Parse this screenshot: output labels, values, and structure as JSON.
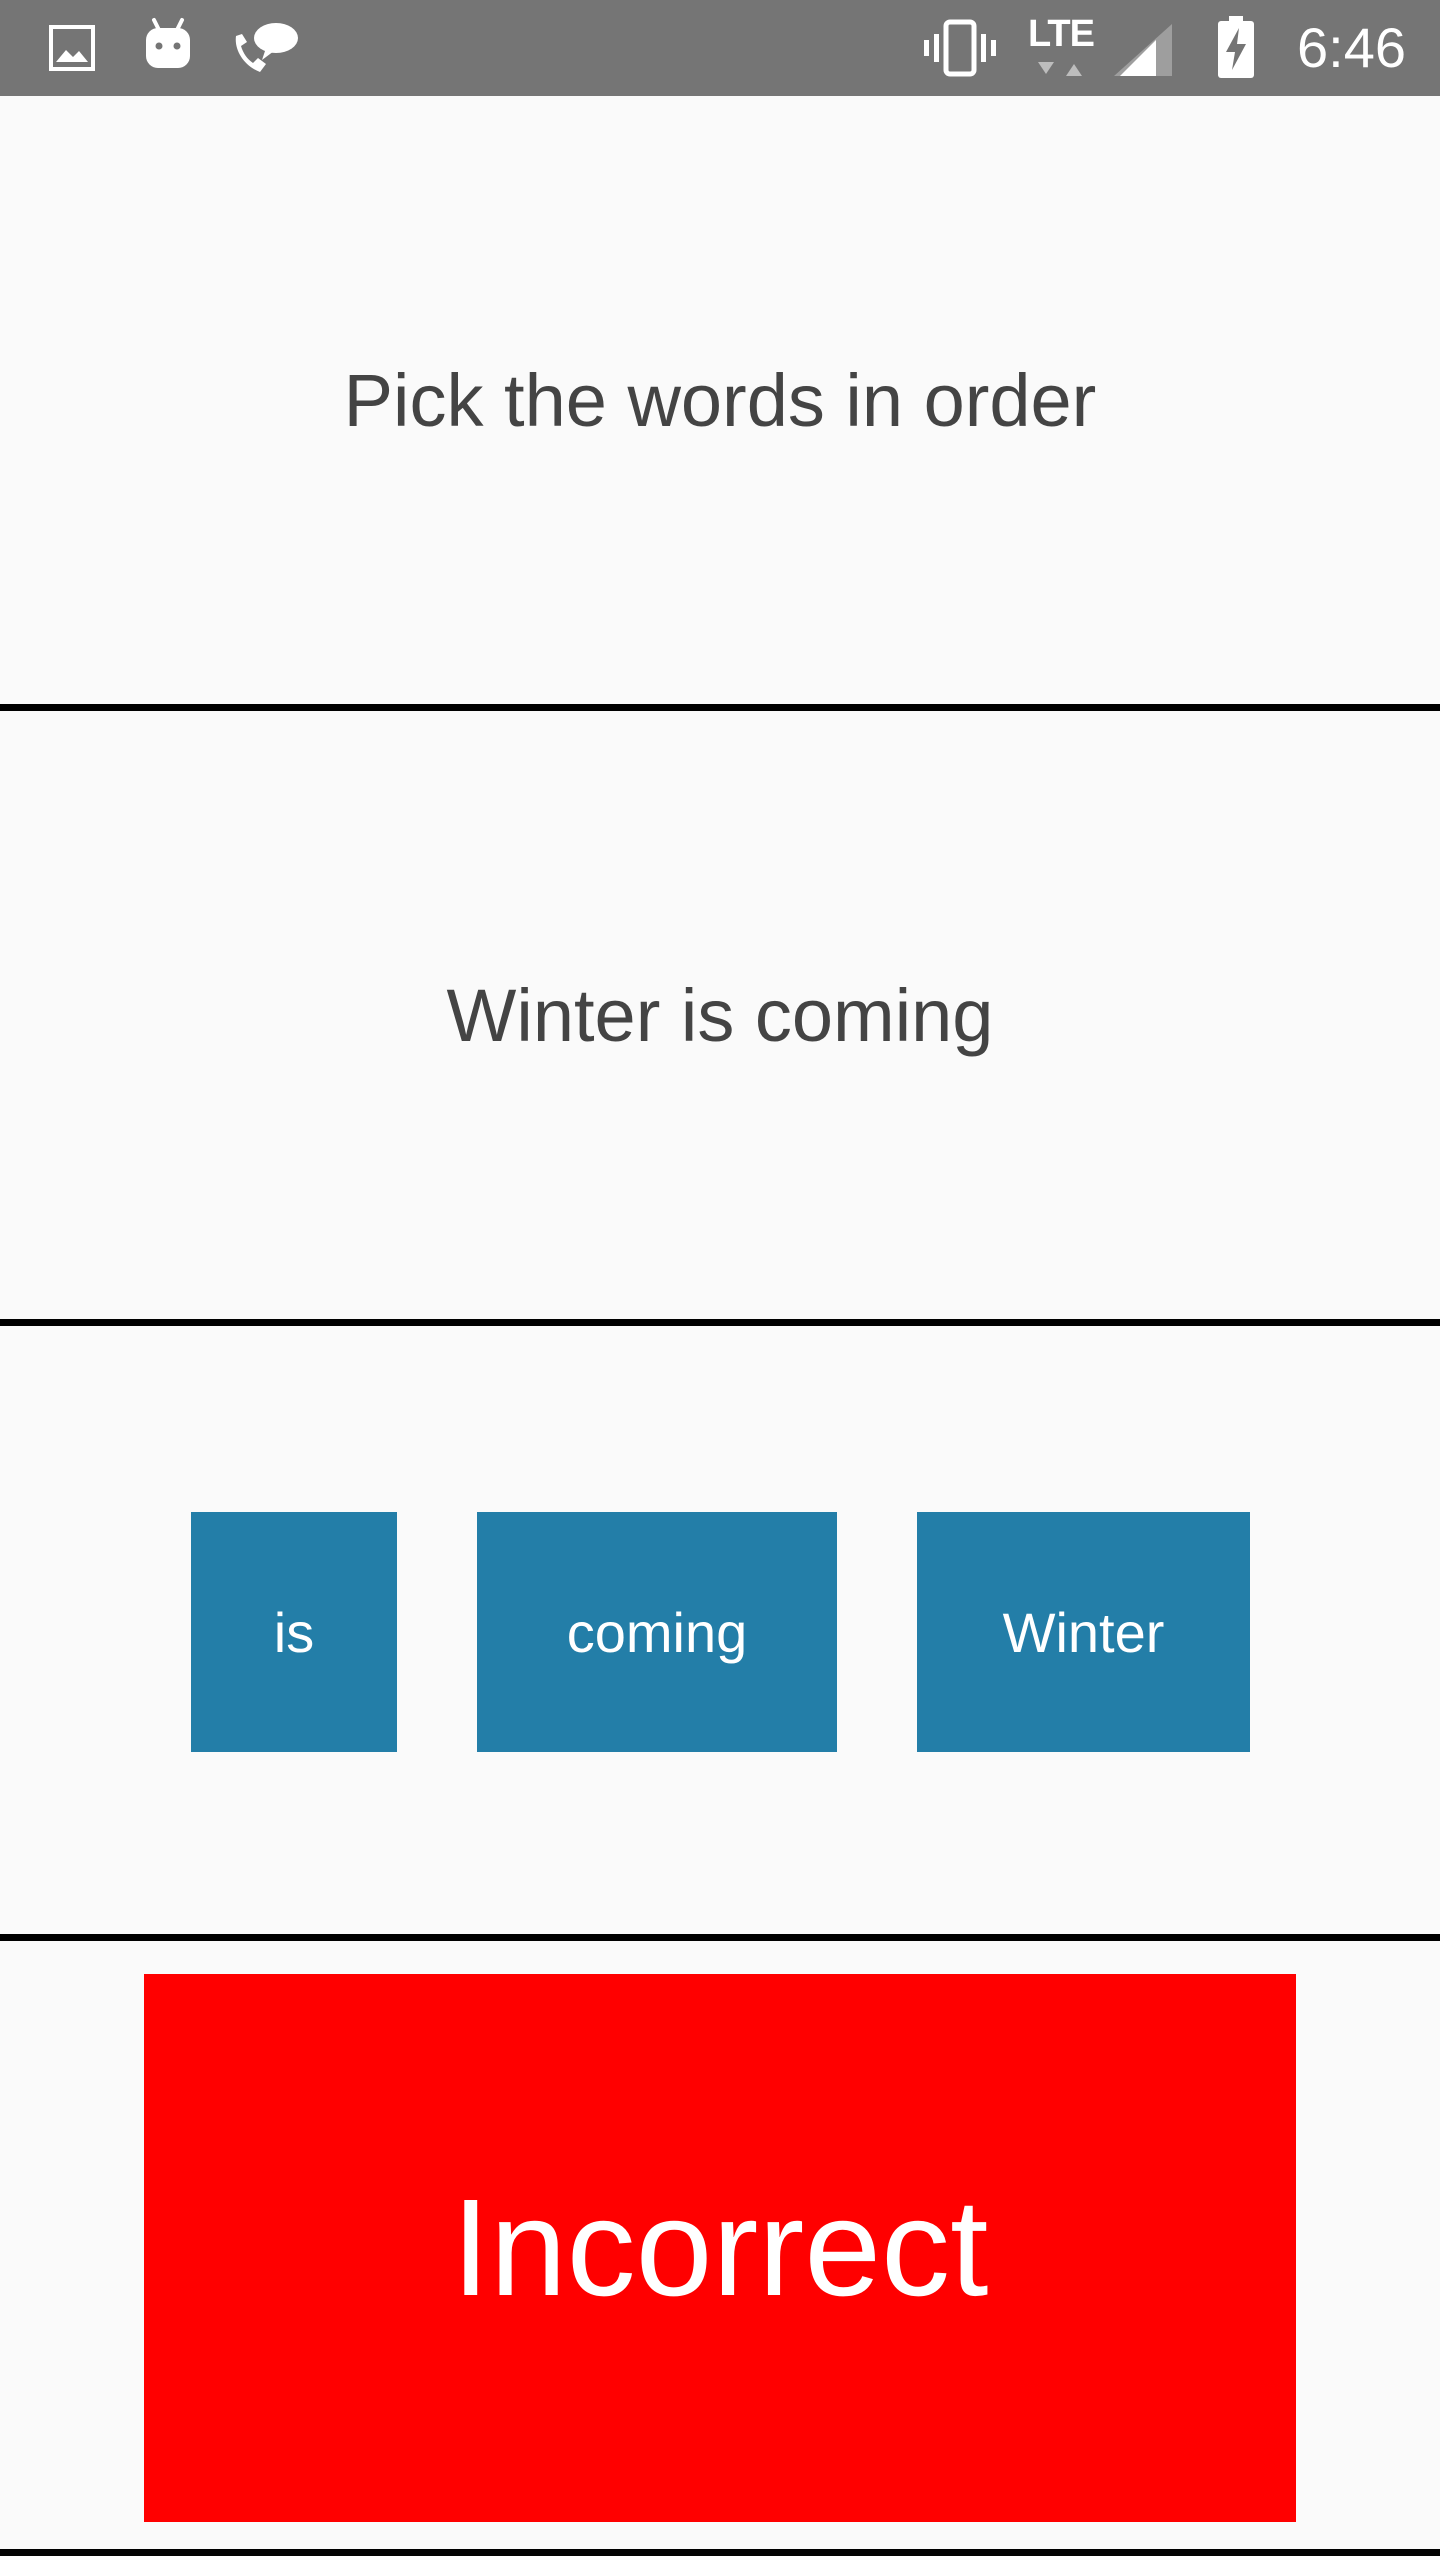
{
  "status_bar": {
    "time": "6:46",
    "network": "LTE",
    "icons": [
      "image-icon",
      "android-icon",
      "call-message-icon",
      "vibrate-icon",
      "lte-icon",
      "signal-icon",
      "battery-charging-icon"
    ]
  },
  "instruction": {
    "text": "Pick the words in order"
  },
  "answer": {
    "text": "Winter is coming"
  },
  "words": [
    {
      "label": "is"
    },
    {
      "label": "coming"
    },
    {
      "label": "Winter"
    }
  ],
  "result": {
    "label": "Incorrect"
  },
  "colors": {
    "status_bar": "#757575",
    "background": "#fafafa",
    "tile": "#237ea8",
    "result_incorrect": "#ff0000",
    "divider": "#000000",
    "text": "#444444"
  }
}
